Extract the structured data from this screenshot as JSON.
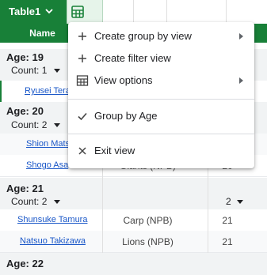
{
  "table_tab": {
    "label": "Table1"
  },
  "header": {
    "name_col": "Name"
  },
  "groups": [
    {
      "title": "Age: 19",
      "count": "Count: 1"
    },
    {
      "title": "Age: 20",
      "count": "Count: 2"
    },
    {
      "title": "Age: 21",
      "count": "Count: 2",
      "right_count": "2"
    },
    {
      "title": "Age: 22"
    }
  ],
  "rows": [
    {
      "name": "Ryusei Tera"
    },
    {
      "name": "Shion Mats"
    },
    {
      "name": "Shogo Asa",
      "team": "Giants (NPB)",
      "age": "20"
    },
    {
      "name": "Shunsuke Tamura",
      "team": "Carp (NPB)",
      "age": "21"
    },
    {
      "name": "Natsuo Takizawa",
      "team": "Lions (NPB)",
      "age": "21"
    }
  ],
  "menu": {
    "items": [
      {
        "label": "Create group by view",
        "icon": "plus-icon",
        "submenu": true
      },
      {
        "label": "Create filter view",
        "icon": "plus-icon"
      },
      {
        "label": "View options",
        "icon": "table-icon",
        "submenu": true
      },
      {
        "label": "Group by Age",
        "icon": "check-icon"
      },
      {
        "label": "Exit view",
        "icon": "close-icon"
      }
    ]
  },
  "colors": {
    "accent": "#188038",
    "link": "#1a57c8",
    "group_bg": "#f1f3f4"
  }
}
